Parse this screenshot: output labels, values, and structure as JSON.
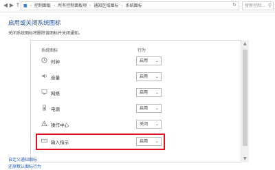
{
  "address_bar": {
    "crumbs": [
      "控制面板",
      "所有控制面板项",
      "通知区域图标",
      "系统图标"
    ],
    "search_placeholder": "搜索控制..."
  },
  "page": {
    "title": "启用或关闭系统图标",
    "description": "关闭系统图标将删除该图标并关闭通知。"
  },
  "table": {
    "col_icon": "系统图标",
    "col_behavior": "行为",
    "rows": [
      {
        "label": "时钟",
        "value": "启用",
        "icon": "clock-icon"
      },
      {
        "label": "音量",
        "value": "启用",
        "icon": "volume-icon"
      },
      {
        "label": "网络",
        "value": "启用",
        "icon": "network-icon"
      },
      {
        "label": "电源",
        "value": "启用",
        "icon": "power-icon"
      },
      {
        "label": "操作中心",
        "value": "关闭",
        "icon": "action-center-icon"
      },
      {
        "label": "输入指示",
        "value": "启用",
        "icon": "keyboard-icon"
      }
    ]
  },
  "links": {
    "customize": "自定义通知图标",
    "restore": "还原默认图标行为"
  },
  "colors": {
    "title": "#1e4f9c",
    "link": "#1e5fc2",
    "highlight": "#e01020"
  }
}
